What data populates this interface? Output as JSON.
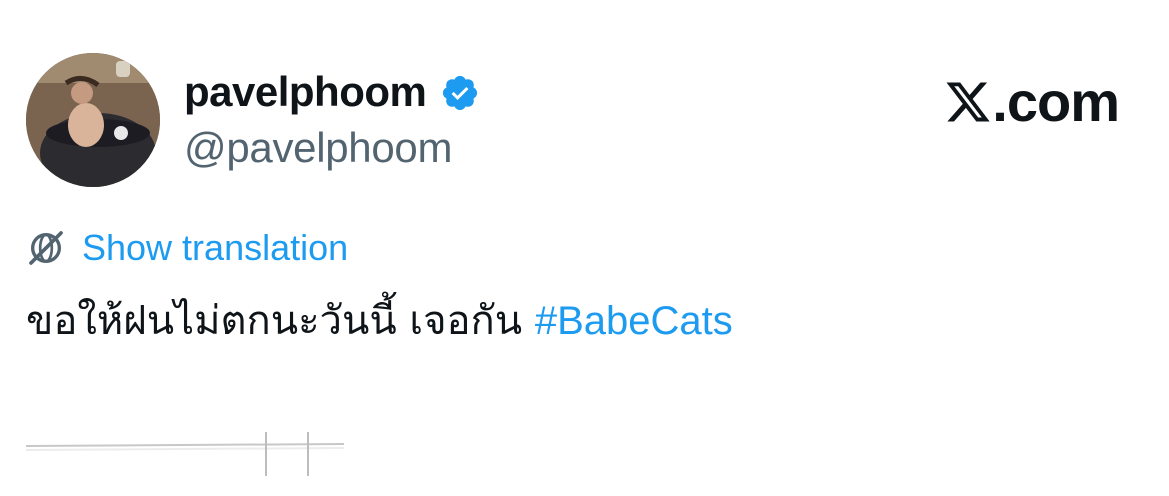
{
  "author": {
    "display_name": "pavelphoom",
    "handle": "@pavelphoom",
    "verified": true,
    "avatar": "profile-photo"
  },
  "site": {
    "logo_icon": "x-logo-icon",
    "label": ".com"
  },
  "translation": {
    "icon": "globe-icon",
    "label": "Show translation"
  },
  "tweet": {
    "text": "ขอให้ฝนไม่ตกนะวันนี้ เจอกัน ",
    "hashtag": "#BabeCats"
  },
  "colors": {
    "link": "#1d9bf0",
    "verified": "#1d9bf0",
    "text": "#0f1419",
    "muted": "#536471"
  }
}
